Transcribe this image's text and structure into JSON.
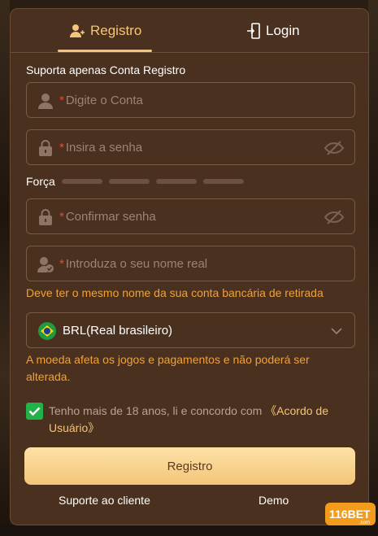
{
  "tabs": {
    "register_label": "Registro",
    "login_label": "Login"
  },
  "form": {
    "account_section_label": "Suporta apenas Conta Registro",
    "account_placeholder": "Digite o Conta",
    "password_placeholder": "Insira a senha",
    "strength_label": "Força",
    "confirm_placeholder": "Confirmar senha",
    "realname_placeholder": "Introduza o seu nome real",
    "required_mark": "*",
    "realname_note": "Deve ter o mesmo nome da sua conta bancária de retirada",
    "currency_value": "BRL(Real brasileiro)",
    "currency_note": "A moeda afeta os jogos e pagamentos e não poderá ser alterada.",
    "agree_text": "Tenho mais de 18 anos, li e concordo com",
    "agree_link": "《Acordo de Usuário》",
    "agree_checked": true,
    "submit_label": "Registro"
  },
  "footer": {
    "support_label": "Suporte ao cliente",
    "demo_label": "Demo"
  },
  "brand": {
    "logo_text": "116BET",
    "logo_suffix": ".com"
  },
  "colors": {
    "accent": "#f4c57a",
    "panel": "#4a301f",
    "warning": "#f0a23a",
    "check": "#21b34a"
  }
}
